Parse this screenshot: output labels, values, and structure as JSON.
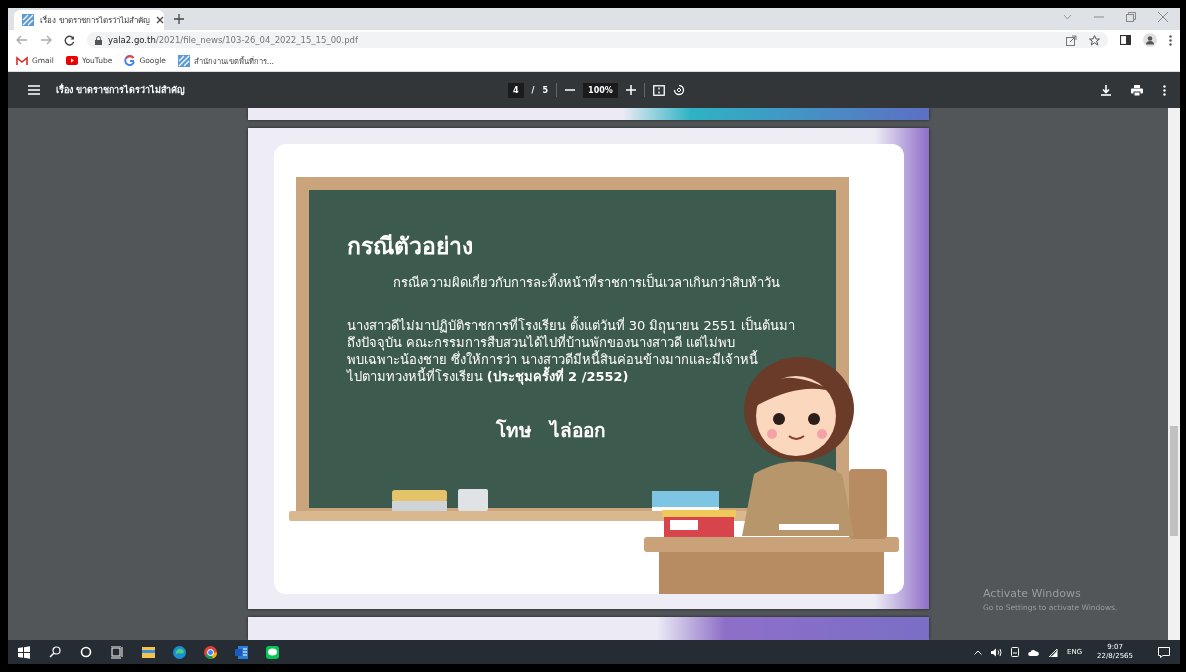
{
  "browser": {
    "tabs": [
      {
        "title": "เรื่อง ขาดราชการไดรว่าไม่สำคัญ",
        "selected": true
      }
    ],
    "url": {
      "host": "yala2.go.th",
      "path": "/2021/file_news/103-26_04_2022_15_15_00.pdf"
    },
    "bookmarks": [
      {
        "kind": "gmail",
        "label": "Gmail"
      },
      {
        "kind": "youtube",
        "label": "YouTube"
      },
      {
        "kind": "google",
        "label": "Google"
      },
      {
        "kind": "site",
        "label": "สำนักงานเขตพื้นที่การ..."
      }
    ]
  },
  "pdf_toolbar": {
    "title": "เรื่อง ขาดราชการไดรว่าไม่สำคัญ",
    "page": "4",
    "separator": "/",
    "page_count": "5",
    "zoom": "100%"
  },
  "slide": {
    "heading": "กรณีตัวอย่าง",
    "subtitle": "กรณีความผิดเกี่ยวกับการละทิ้งหน้าที่ราชการเป็นเวลาเกินกว่าสิบห้าวัน",
    "body": "นางสาวดีไม่มาปฏิบัติราชการที่โรงเรียน ตั้งแต่วันที่ 30 มิถุนายน 2551 เป็นต้นมา\nถึงปัจจุบัน คณะกรรมการสืบสวนได้ไปที่บ้านพักของนางสาวดี แต่ไม่พบ\nพบเฉพาะน้องชาย ซึ่งให้การว่า นางสาวดีมีหนี้สินค่อนข้างมากและมีเจ้าหนี้\nไปตามทวงหนี้ที่โรงเรียน **(ประชุมครั้งที่ 2 /2552)**",
    "penalty_label": "โทษ",
    "penalty_value": "ไล่ออก"
  },
  "activation_notice": {
    "title": "Activate Windows",
    "subtitle": "Go to Settings to activate Windows."
  },
  "taskbar": {
    "apps": [
      {
        "kind": "start"
      },
      {
        "kind": "search"
      },
      {
        "kind": "cortana"
      },
      {
        "kind": "taskview"
      },
      {
        "kind": "folder"
      },
      {
        "kind": "edge"
      },
      {
        "kind": "chrome"
      },
      {
        "kind": "word"
      },
      {
        "kind": "line"
      }
    ],
    "language": "ENG",
    "time": "9:07",
    "date": "22/8/2565"
  }
}
